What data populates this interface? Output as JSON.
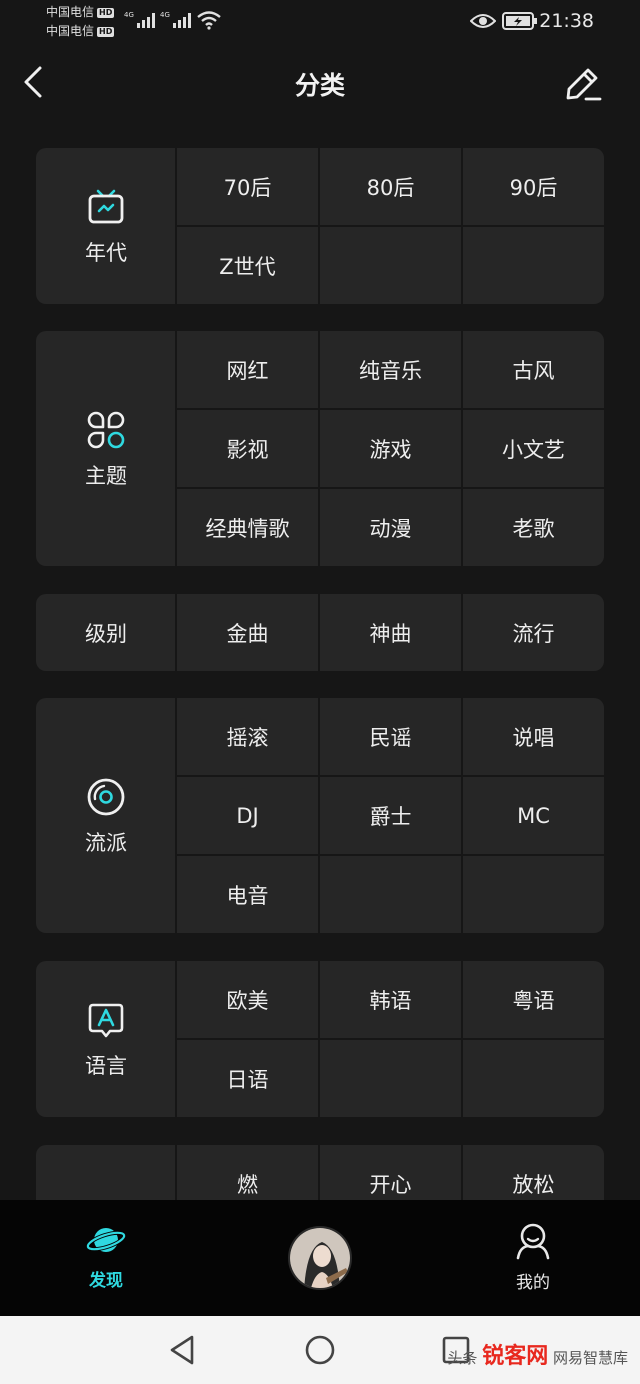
{
  "status_bar": {
    "carrier_1": "中国电信",
    "carrier_2": "中国电信",
    "hd": "HD",
    "net_1": "4G",
    "net_2": "4G",
    "time": "21:38"
  },
  "header": {
    "title": "分类"
  },
  "categories": [
    {
      "label": "年代",
      "icon": "tv-icon",
      "items": [
        "70后",
        "80后",
        "90后",
        "Z世代",
        "",
        ""
      ]
    },
    {
      "label": "主题",
      "icon": "theme-grid-icon",
      "items": [
        "网红",
        "纯音乐",
        "古风",
        "影视",
        "游戏",
        "小文艺",
        "经典情歌",
        "动漫",
        "老歌"
      ]
    },
    {
      "label": "级别",
      "icon": "",
      "items": [
        "金曲",
        "神曲",
        "流行"
      ]
    },
    {
      "label": "流派",
      "icon": "vinyl-icon",
      "items": [
        "摇滚",
        "民谣",
        "说唱",
        "DJ",
        "爵士",
        "MC",
        "电音",
        "",
        ""
      ]
    },
    {
      "label": "语言",
      "icon": "language-a-icon",
      "items": [
        "欧美",
        "韩语",
        "粤语",
        "日语",
        "",
        ""
      ]
    },
    {
      "label": "",
      "icon": "",
      "items": [
        "燃",
        "开心",
        "放松"
      ]
    }
  ],
  "bottom_nav": {
    "discover_label": "发现",
    "mine_label": "我的"
  },
  "watermark": {
    "left_text": "头条",
    "brand": "锐客网",
    "right_text": "网易智慧库"
  },
  "colors": {
    "accent": "#2fd9e0",
    "card": "#262626",
    "background": "#161616"
  }
}
